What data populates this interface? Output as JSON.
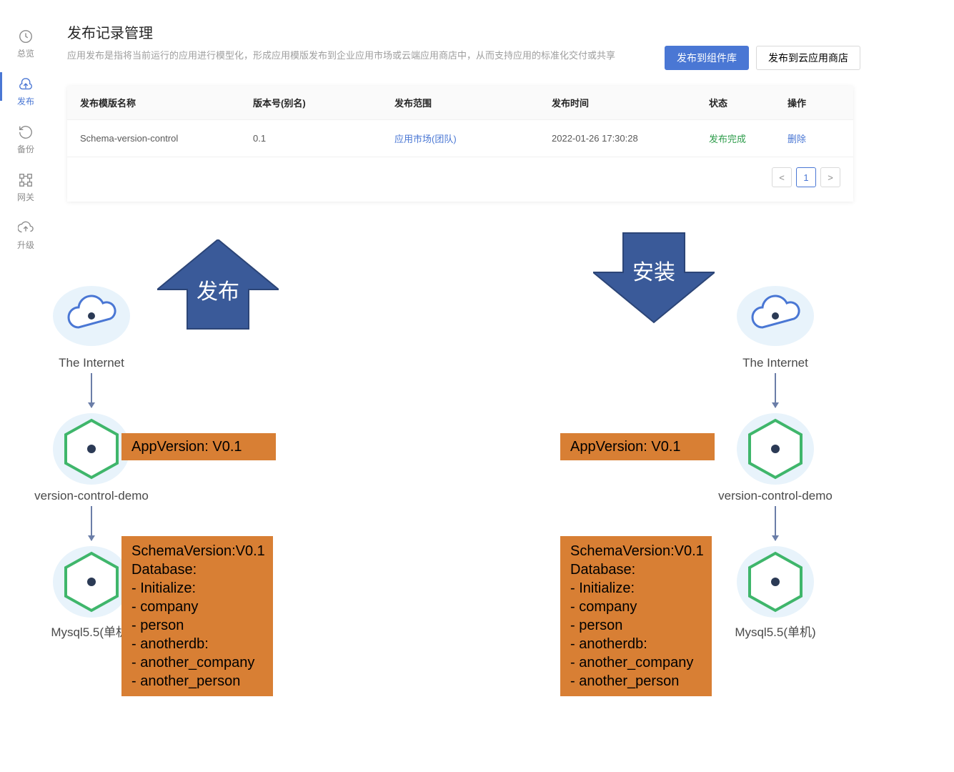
{
  "sidebar": {
    "items": [
      {
        "label": "总览"
      },
      {
        "label": "发布"
      },
      {
        "label": "备份"
      },
      {
        "label": "网关"
      },
      {
        "label": "升级"
      }
    ]
  },
  "header": {
    "title": "发布记录管理",
    "desc": "应用发布是指将当前运行的应用进行模型化，形成应用模版发布到企业应用市场或云端应用商店中，从而支持应用的标准化交付或共享",
    "btn_primary": "发布到组件库",
    "btn_secondary": "发布到云应用商店"
  },
  "table": {
    "columns": {
      "name": "发布模版名称",
      "ver": "版本号(别名)",
      "scope": "发布范围",
      "time": "发布时间",
      "status": "状态",
      "ops": "操作"
    },
    "rows": [
      {
        "name": "Schema-version-control",
        "ver": "0.1",
        "scope": "应用市场(团队)",
        "time": "2022-01-26 17:30:28",
        "status": "发布完成",
        "ops": "删除"
      }
    ],
    "pager": {
      "prev": "<",
      "page": "1",
      "next": ">"
    }
  },
  "diagram": {
    "arrow_publish": "发布",
    "arrow_install": "安装",
    "internet_label": "The Internet",
    "app_label": "version-control-demo",
    "db_label": "Mysql5.5(单机)",
    "note_app": "AppVersion: V0.1",
    "note_schema": "SchemaVersion:V0.1\nDatabase:\n - Initialize:\n    - company\n    - person\n - anotherdb:\n    - another_company\n    - another_person"
  }
}
